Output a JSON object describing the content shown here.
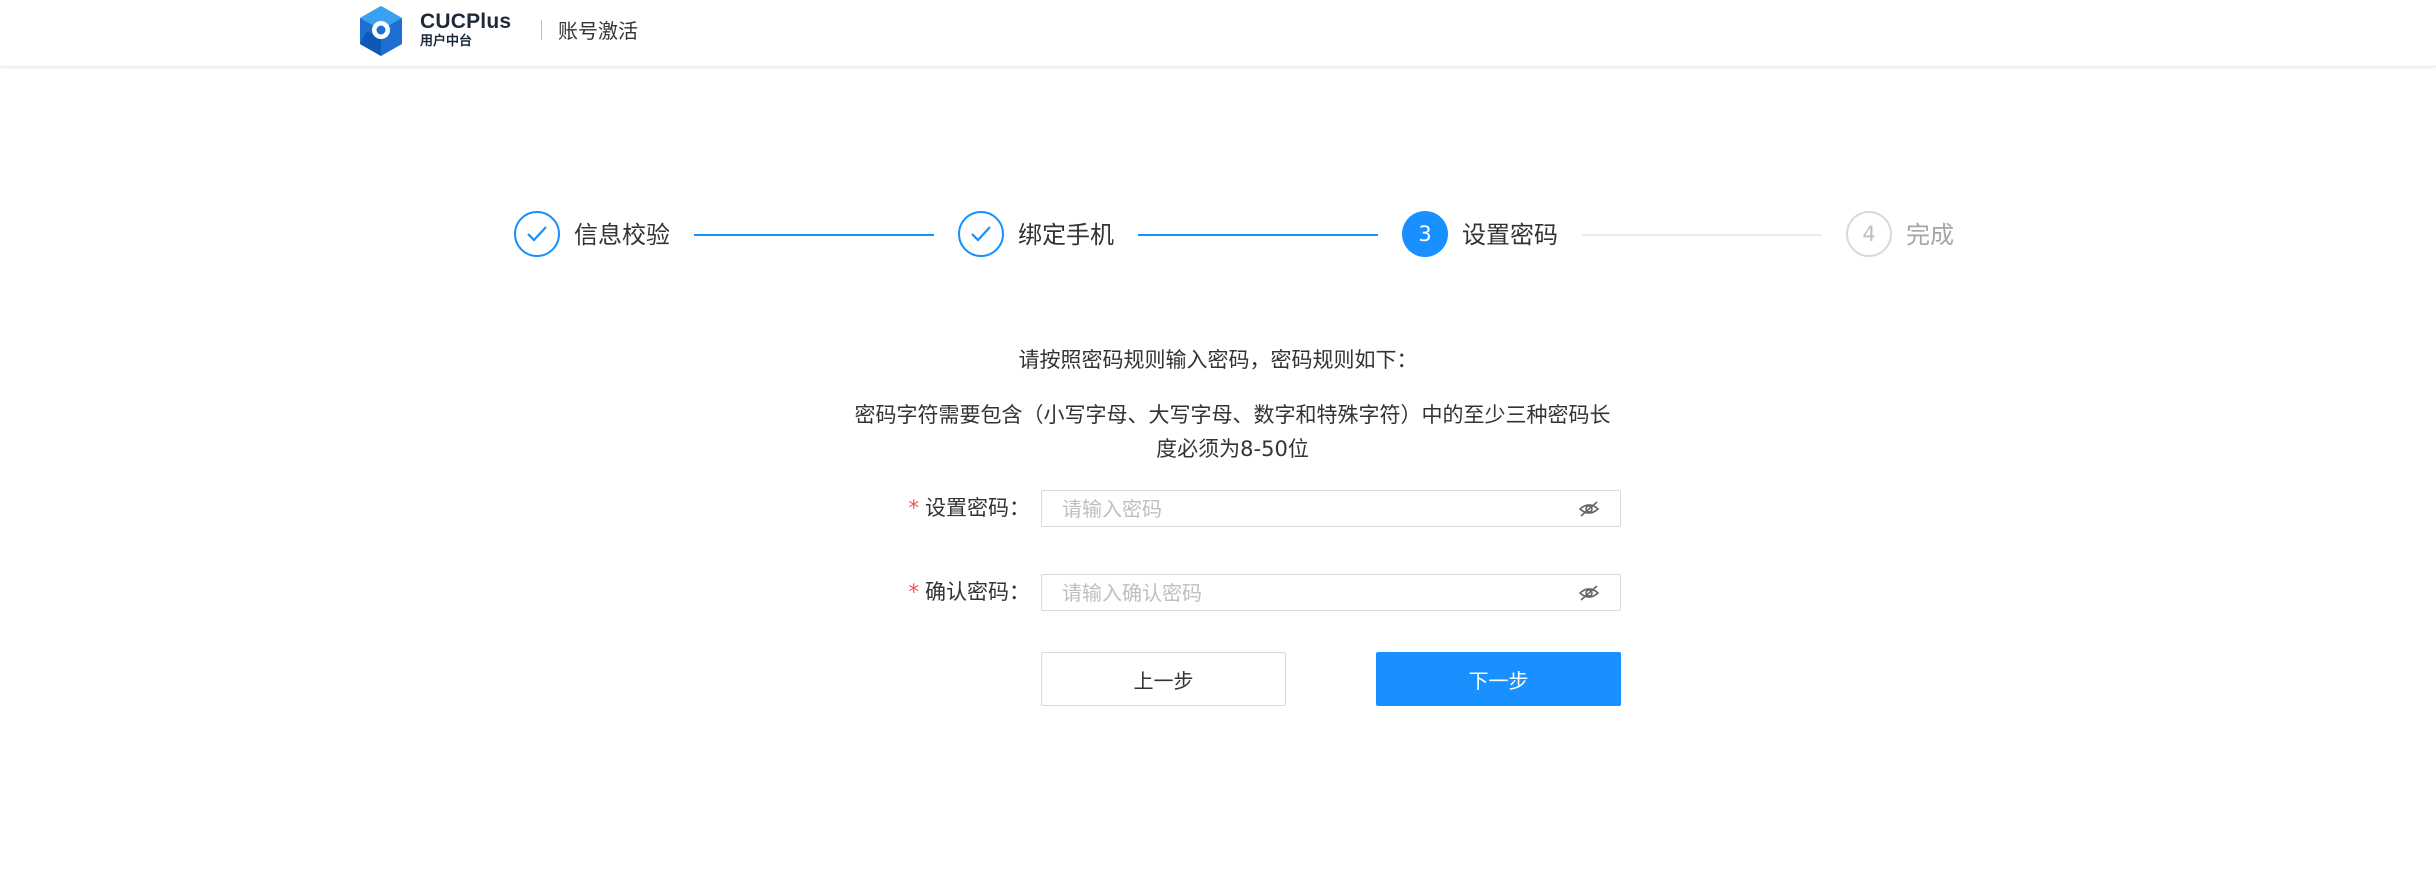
{
  "header": {
    "brand_name": "CUCPlus",
    "brand_sub": "用户中台",
    "page_title": "账号激活"
  },
  "steps": [
    {
      "label": "信息校验",
      "status": "done"
    },
    {
      "label": "绑定手机",
      "status": "done"
    },
    {
      "label": "设置密码",
      "status": "current",
      "number": "3"
    },
    {
      "label": "完成",
      "status": "wait",
      "number": "4"
    }
  ],
  "main": {
    "notice": "请按照密码规则输入密码，密码规则如下：",
    "rules": "密码字符需要包含（小写字母、大写字母、数字和特殊字符）中的至少三种密码长度必须为8-50位"
  },
  "form": {
    "required_mark": "*",
    "password": {
      "label": "设置密码：",
      "placeholder": "请输入密码",
      "value": ""
    },
    "confirm": {
      "label": "确认密码：",
      "placeholder": "请输入确认密码",
      "value": ""
    }
  },
  "buttons": {
    "prev_label": "上一步",
    "next_label": "下一步"
  },
  "colors": {
    "primary": "#1890ff",
    "required": "#ff4d4f",
    "wait": "#bfbfbf"
  }
}
